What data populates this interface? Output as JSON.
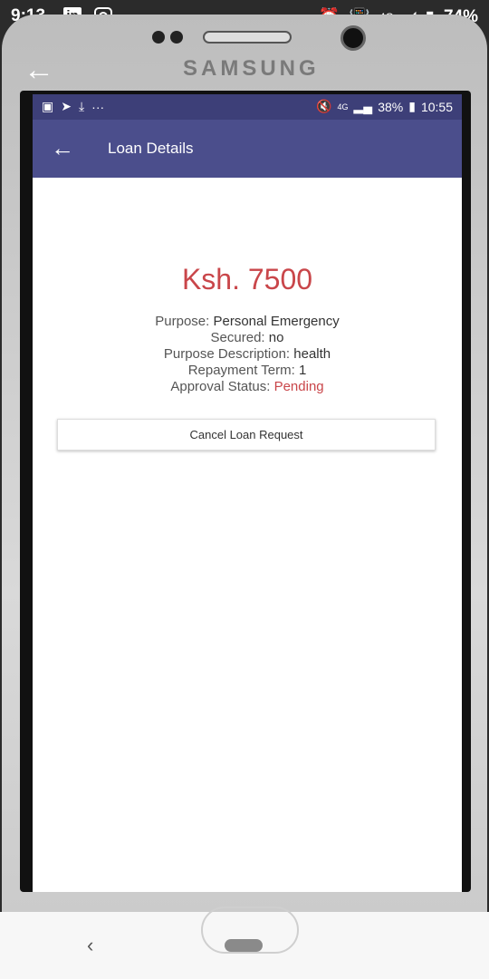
{
  "outer_status": {
    "time": "9:13",
    "linkedin_letters": "in",
    "network": "4G",
    "battery": "74%"
  },
  "phone": {
    "brand": "SAMSUNG"
  },
  "inner_status": {
    "ellipsis": "···",
    "network": "4G",
    "battery": "38%",
    "time": "10:55"
  },
  "appbar": {
    "title": "Loan Details"
  },
  "loan": {
    "amount": "Ksh. 7500",
    "purpose_label": "Purpose:",
    "purpose_value": "Personal Emergency",
    "secured_label": "Secured:",
    "secured_value": "no",
    "description_label": "Purpose Description:",
    "description_value": "health",
    "term_label": "Repayment Term:",
    "term_value": "1",
    "status_label": "Approval Status:",
    "status_value": "Pending"
  },
  "actions": {
    "cancel_label": "Cancel Loan Request"
  },
  "colors": {
    "appbar": "#4b4e8c",
    "accent_red": "#c9464a"
  }
}
